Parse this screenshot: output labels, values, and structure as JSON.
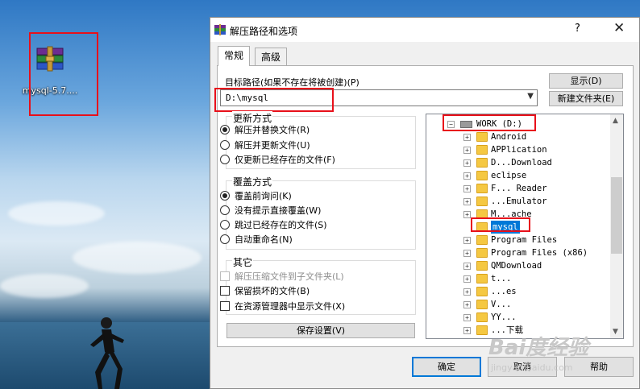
{
  "desktop": {
    "file_label": "mysql-5.7....",
    "file_icon": "winrar-archive-icon"
  },
  "dialog": {
    "title": "解压路径和选项",
    "help": "?",
    "close": "✕",
    "tabs": [
      {
        "label": "常规",
        "active": true
      },
      {
        "label": "高级",
        "active": false
      }
    ],
    "target_path_label": "目标路径(如果不存在将被创建)(P)",
    "target_path_value": "D:\\mysql",
    "show_button": "显示(D)",
    "new_folder_button": "新建文件夹(E)",
    "update_group": {
      "title": "更新方式",
      "options": [
        {
          "label": "解压并替换文件(R)",
          "checked": true
        },
        {
          "label": "解压并更新文件(U)",
          "checked": false
        },
        {
          "label": "仅更新已经存在的文件(F)",
          "checked": false
        }
      ]
    },
    "overwrite_group": {
      "title": "覆盖方式",
      "options": [
        {
          "label": "覆盖前询问(K)",
          "checked": true
        },
        {
          "label": "没有提示直接覆盖(W)",
          "checked": false
        },
        {
          "label": "跳过已经存在的文件(S)",
          "checked": false
        },
        {
          "label": "自动重命名(N)",
          "checked": false
        }
      ]
    },
    "misc_group": {
      "title": "其它",
      "options": [
        {
          "label": "解压压缩文件到子文件夹(L)",
          "checked": false,
          "disabled": true
        },
        {
          "label": "保留损坏的文件(B)",
          "checked": false,
          "disabled": false
        },
        {
          "label": "在资源管理器中显示文件(X)",
          "checked": false,
          "disabled": false
        }
      ]
    },
    "save_settings_button": "保存设置(V)",
    "ok_button": "确定",
    "cancel_button": "取消",
    "help_button": "帮助"
  },
  "tree": {
    "root": "WORK (D:)",
    "items": [
      {
        "label": "Android",
        "expandable": true
      },
      {
        "label": "APPlication",
        "expandable": true
      },
      {
        "label": "D...Download",
        "expandable": true
      },
      {
        "label": "eclipse",
        "expandable": true
      },
      {
        "label": "F... Reader",
        "expandable": true
      },
      {
        "label": "...Emulator",
        "expandable": true
      },
      {
        "label": "M...ache",
        "expandable": true
      },
      {
        "label": "mysql",
        "expandable": false,
        "selected": true
      },
      {
        "label": "Program Files",
        "expandable": true
      },
      {
        "label": "Program Files (x86)",
        "expandable": true
      },
      {
        "label": "QMDownload",
        "expandable": true
      },
      {
        "label": "t...",
        "expandable": true
      },
      {
        "label": "...es",
        "expandable": true
      },
      {
        "label": "V...",
        "expandable": true
      },
      {
        "label": "YY...",
        "expandable": true
      },
      {
        "label": "...下载",
        "expandable": true
      }
    ]
  },
  "watermark": {
    "logo": "Bai度经验",
    "url": "jingyan.baidu.com"
  }
}
